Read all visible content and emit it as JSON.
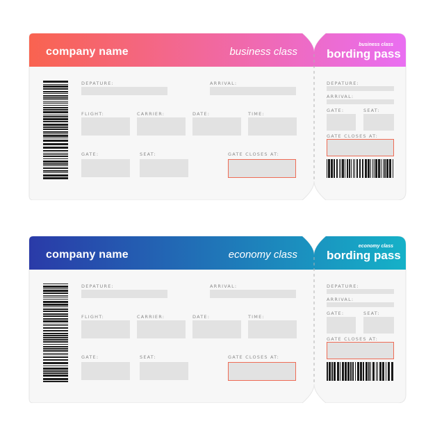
{
  "tickets": [
    {
      "company_name": "company name",
      "class_label": "business class",
      "stub_class_label": "business class",
      "stub_title": "bording pass",
      "gradient": {
        "from": "#f9634f",
        "to": "#e96ef3"
      },
      "labels": {
        "departure": "DEPATURE:",
        "arrival": "ARRIVAL:",
        "flight": "FLIGHT:",
        "carrier": "CARRIER:",
        "date": "DATE:",
        "time": "TIME:",
        "gate": "GATE:",
        "seat": "SEAT:",
        "gate_closes": "GATE CLOSES AT:"
      }
    },
    {
      "company_name": "company name",
      "class_label": "economy class",
      "stub_class_label": "economy class",
      "stub_title": "bording pass",
      "gradient": {
        "from": "#2a3aa8",
        "to": "#15b2c8"
      },
      "labels": {
        "departure": "DEPATURE:",
        "arrival": "ARRIVAL:",
        "flight": "FLIGHT:",
        "carrier": "CARRIER:",
        "date": "DATE:",
        "time": "TIME:",
        "gate": "GATE:",
        "seat": "SEAT:",
        "gate_closes": "GATE CLOSES AT:"
      }
    }
  ],
  "colors": {
    "card_bg": "#f7f7f7",
    "field_bg": "#e2e2e2",
    "gate_border": "#ef6b55",
    "label_text": "#8a8a8a"
  },
  "icons": [
    "vertical-barcode",
    "horizontal-barcode"
  ]
}
